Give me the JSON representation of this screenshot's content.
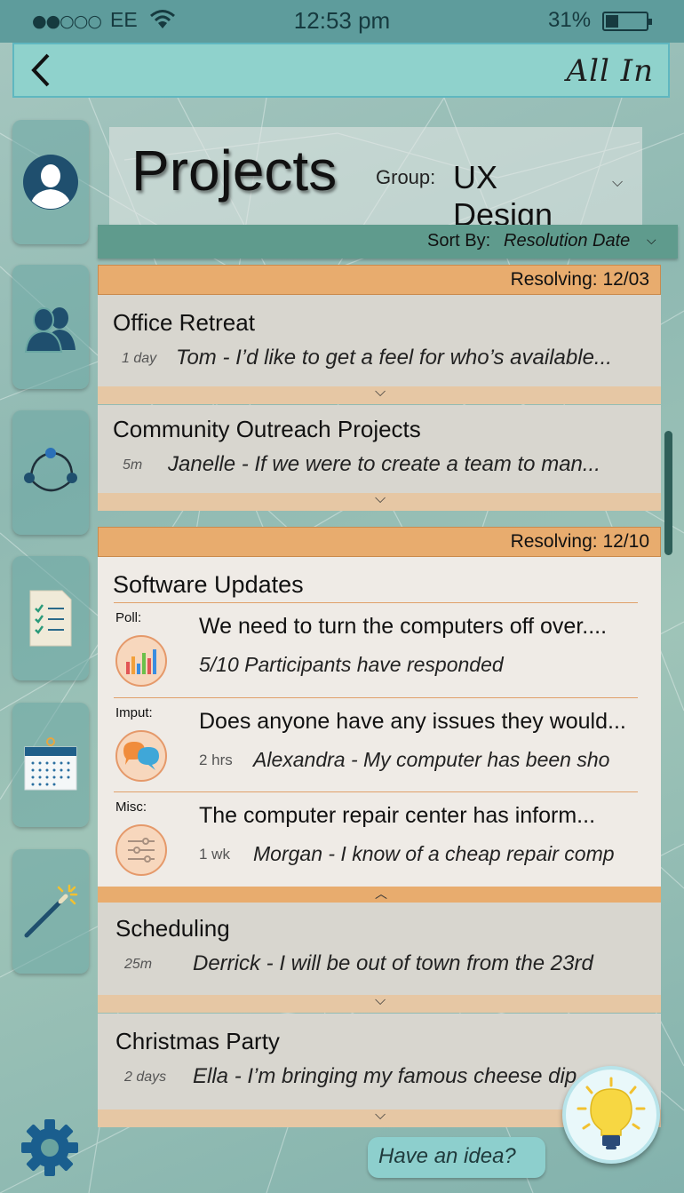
{
  "status_bar": {
    "signal": "●●○○○",
    "carrier": "EE",
    "time": "12:53 pm",
    "battery_percent": "31%",
    "battery_level": 0.31
  },
  "nav": {
    "back_icon": "chevron-left-icon",
    "brand": "All In"
  },
  "sidebar": {
    "items": [
      {
        "name": "profile",
        "icon": "user-icon"
      },
      {
        "name": "groups",
        "icon": "users-icon"
      },
      {
        "name": "network",
        "icon": "share-icon"
      },
      {
        "name": "tasks",
        "icon": "checklist-icon"
      },
      {
        "name": "calendar",
        "icon": "calendar-icon"
      },
      {
        "name": "ideas",
        "icon": "magic-wand-icon"
      }
    ],
    "settings_icon": "gear-icon"
  },
  "header": {
    "title": "Projects",
    "group_label": "Group:",
    "group_value": "UX Design"
  },
  "sort": {
    "label": "Sort By:",
    "value": "Resolution Date"
  },
  "sections": [
    {
      "resolving": "Resolving:   12/03",
      "cards": [
        {
          "title": "Office Retreat",
          "time": "1 day",
          "message": "Tom - I’d like to get a feel for who’s available..."
        },
        {
          "title": "Community Outreach Projects",
          "time": "5m",
          "message": "Janelle - If we were to create a team to man..."
        }
      ]
    },
    {
      "resolving": "Resolving:   12/10",
      "expanded_card": {
        "title": "Software Updates",
        "items": [
          {
            "type": "Poll:",
            "icon": "bar-chart-icon",
            "title": "We need to turn the computers off over....",
            "time": "",
            "message": "5/10 Participants have responded"
          },
          {
            "type": "Imput:",
            "icon": "chat-bubbles-icon",
            "title": "Does anyone have any issues they would...",
            "time": "2 hrs",
            "message": "Alexandra - My computer has been sho"
          },
          {
            "type": "Misc:",
            "icon": "sliders-icon",
            "title": "The computer repair center has inform...",
            "time": "1 wk",
            "message": "Morgan - I know of a cheap repair comp"
          }
        ]
      },
      "cards": [
        {
          "title": "Scheduling",
          "time": "25m",
          "message": "Derrick - I will be out of town from the 23rd"
        },
        {
          "title": "Christmas Party",
          "time": "2 days",
          "message": "Ella - I’m bringing my famous cheese dip"
        }
      ]
    }
  ],
  "idea": {
    "label": "Have an idea?",
    "icon": "lightbulb-icon"
  },
  "colors": {
    "accent_orange": "#e8ac6e",
    "nav_teal": "#8fd2cc",
    "icon_navy": "#1f4f6e"
  }
}
